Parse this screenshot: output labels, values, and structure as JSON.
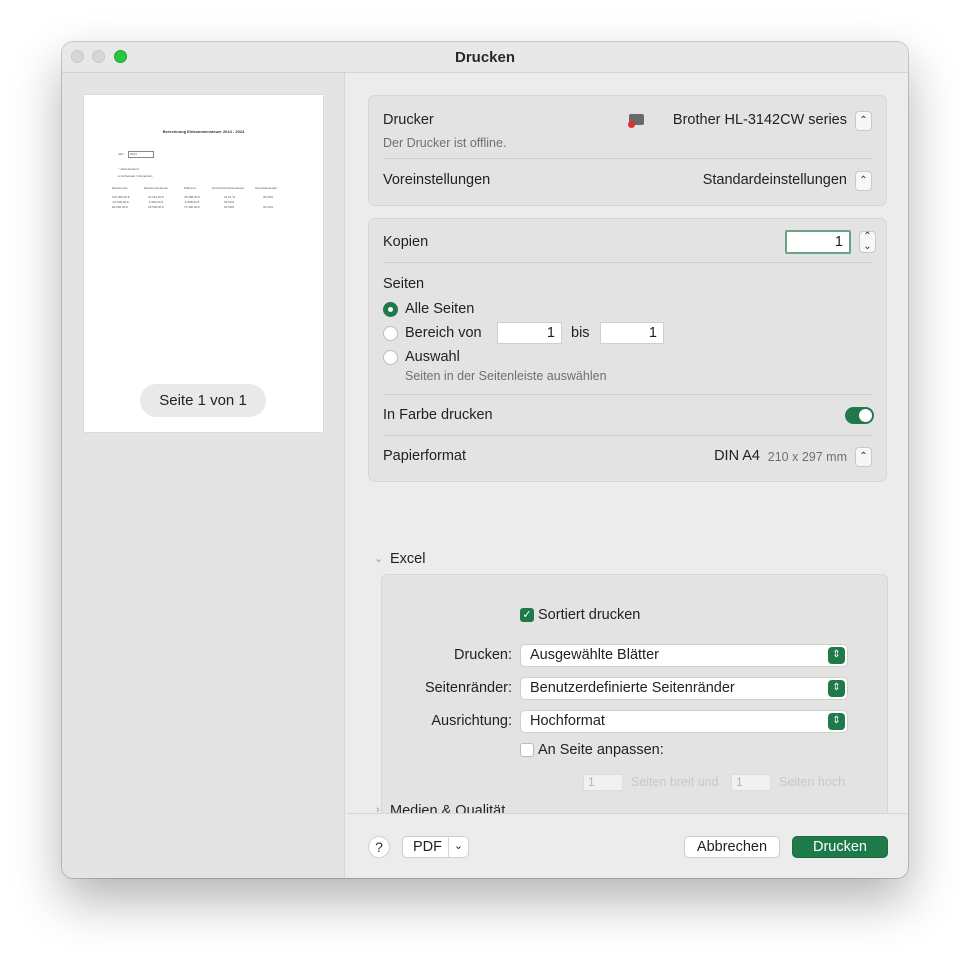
{
  "window": {
    "title": "Drucken"
  },
  "preview": {
    "doc_title": "Berechnung Einkommensteuer 2013 - 2024",
    "jahr_label": "Jahr",
    "jahr_value": "2024",
    "opt1": "Alleinstehend",
    "opt2": "Verheiratet / Verpartnert",
    "columns": [
      "Einkommen",
      "Einkommensteuer",
      "Differenz",
      "Durchschnittssteuersatz",
      "Grenzsteuersatz"
    ],
    "rows": [
      [
        "100.000,00 €",
        "21.612,00 €",
        "78.388,00 €",
        "21,61 %",
        "35,93%"
      ],
      [
        "-10.000,00 €",
        "-3.582,00 €",
        "-6.498,00 €",
        "35,52%",
        ""
      ],
      [
        "90.000,00 €",
        "18.530,00 €",
        "71.490,00 €",
        "20,59%",
        "34,53%"
      ]
    ],
    "page_indicator": "Seite 1 von 1"
  },
  "printer": {
    "label": "Drucker",
    "value": "Brother HL-3142CW series",
    "status": "Der Drucker ist offline.",
    "presets_label": "Voreinstellungen",
    "presets_value": "Standardeinstellungen"
  },
  "copies": {
    "label": "Kopien",
    "value": "1"
  },
  "pages": {
    "label": "Seiten",
    "all": "Alle Seiten",
    "range": "Bereich von",
    "range_from": "1",
    "range_to_label": "bis",
    "range_to": "1",
    "selection": "Auswahl",
    "selection_hint": "Seiten in der Seitenleiste auswählen"
  },
  "color": {
    "label": "In Farbe drucken",
    "enabled": true
  },
  "paper": {
    "label": "Papierformat",
    "value": "DIN A4",
    "dims": "210 x 297 mm"
  },
  "excel": {
    "section_label": "Excel",
    "collate": "Sortiert drucken",
    "collate_checked": true,
    "print_label": "Drucken:",
    "print_value": "Ausgewählte Blätter",
    "margins_label": "Seitenränder:",
    "margins_value": "Benutzerdefinierte Seitenränder",
    "orientation_label": "Ausrichtung:",
    "orientation_value": "Hochformat",
    "fit_label": "An Seite anpassen:",
    "fit_checked": false,
    "fit_wide_value": "1",
    "fit_wide_label": "Seiten breit und",
    "fit_tall_value": "1",
    "fit_tall_label": "Seiten hoch"
  },
  "media": {
    "label": "Medien & Qualität"
  },
  "footer": {
    "help": "?",
    "pdf": "PDF",
    "cancel": "Abbrechen",
    "print": "Drucken"
  },
  "colors": {
    "accent": "#1f7a4a",
    "window_bg": "#ececec"
  }
}
